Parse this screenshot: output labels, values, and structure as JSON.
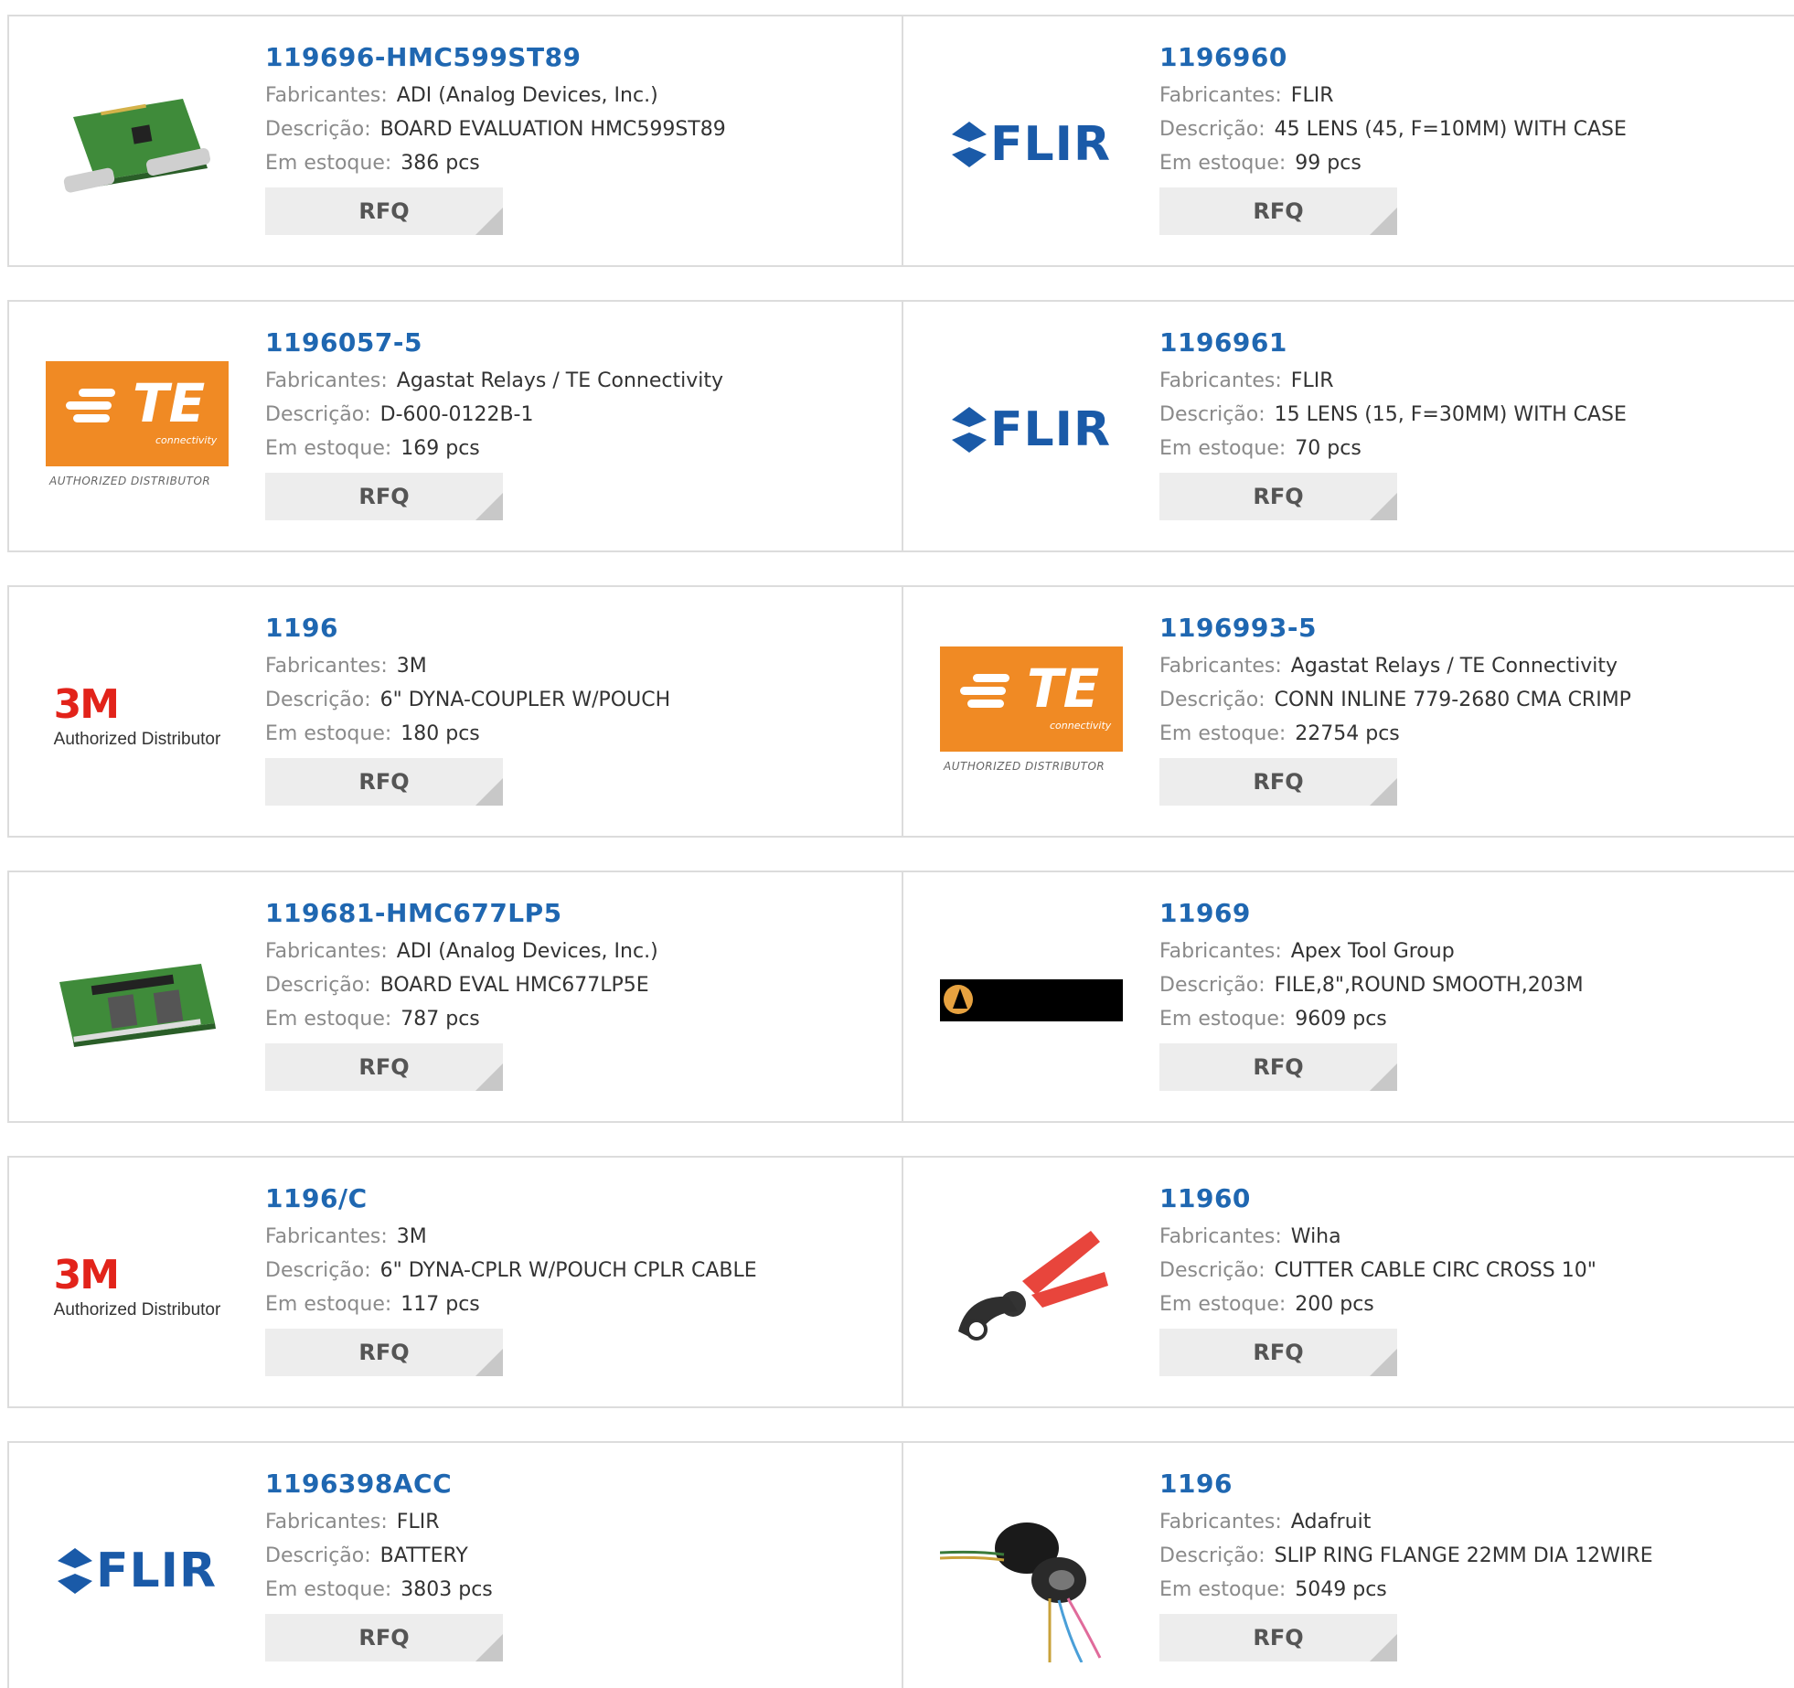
{
  "labels": {
    "manufacturer": "Fabricantes:",
    "description": "Descrição:",
    "stock": "Em estoque:",
    "rfq": "RFQ"
  },
  "products": [
    {
      "part": "119696-HMC599ST89",
      "manufacturer": "ADI (Analog Devices, Inc.)",
      "description": "BOARD EVALUATION HMC599ST89",
      "stock": "386 pcs",
      "image": "pcb-board-photo"
    },
    {
      "part": "1196960",
      "manufacturer": "FLIR",
      "description": "45 LENS (45, F=10MM) WITH CASE",
      "stock": "99 pcs",
      "image": "flir-logo"
    },
    {
      "part": "1196057-5",
      "manufacturer": "Agastat Relays / TE Connectivity",
      "description": "D-600-0122B-1",
      "stock": "169 pcs",
      "image": "te-logo"
    },
    {
      "part": "1196961",
      "manufacturer": "FLIR",
      "description": "15 LENS (15, F=30MM) WITH CASE",
      "stock": "70 pcs",
      "image": "flir-logo"
    },
    {
      "part": "1196",
      "manufacturer": "3M",
      "description": "6\" DYNA-COUPLER W/POUCH",
      "stock": "180 pcs",
      "image": "3m-logo"
    },
    {
      "part": "1196993-5",
      "manufacturer": "Agastat Relays / TE Connectivity",
      "description": "CONN INLINE 779-2680 CMA CRIMP",
      "stock": "22754 pcs",
      "image": "te-logo"
    },
    {
      "part": "119681-HMC677LP5",
      "manufacturer": "ADI (Analog Devices, Inc.)",
      "description": "BOARD EVAL HMC677LP5E",
      "stock": "787 pcs",
      "image": "pcb-board-photo"
    },
    {
      "part": "11969",
      "manufacturer": "Apex Tool Group",
      "description": "FILE,8\",ROUND SMOOTH,203M",
      "stock": "9609 pcs",
      "image": "apex-logo"
    },
    {
      "part": "1196/C",
      "manufacturer": "3M",
      "description": "6\" DYNA-CPLR W/POUCH CPLR CABLE",
      "stock": "117 pcs",
      "image": "3m-logo"
    },
    {
      "part": "11960",
      "manufacturer": "Wiha",
      "description": "CUTTER CABLE CIRC CROSS 10\"",
      "stock": "200 pcs",
      "image": "cable-cutter-photo"
    },
    {
      "part": "1196398ACC",
      "manufacturer": "FLIR",
      "description": "BATTERY",
      "stock": "3803 pcs",
      "image": "flir-logo"
    },
    {
      "part": "1196",
      "manufacturer": "Adafruit",
      "description": "SLIP RING FLANGE 22MM DIA 12WIRE",
      "stock": "5049 pcs",
      "image": "slip-ring-photo"
    }
  ],
  "logo_text": {
    "te": "TE",
    "te_sub": "connectivity",
    "te_auth": "AUTHORIZED DISTRIBUTOR",
    "flir": "FLIR",
    "m3": "3M",
    "m3_auth": "Authorized Distributor"
  },
  "colors": {
    "part_link": "#1f67b1",
    "te_orange": "#f08a24",
    "flir_blue": "#1a5aa8",
    "m3_red": "#e2231a"
  }
}
